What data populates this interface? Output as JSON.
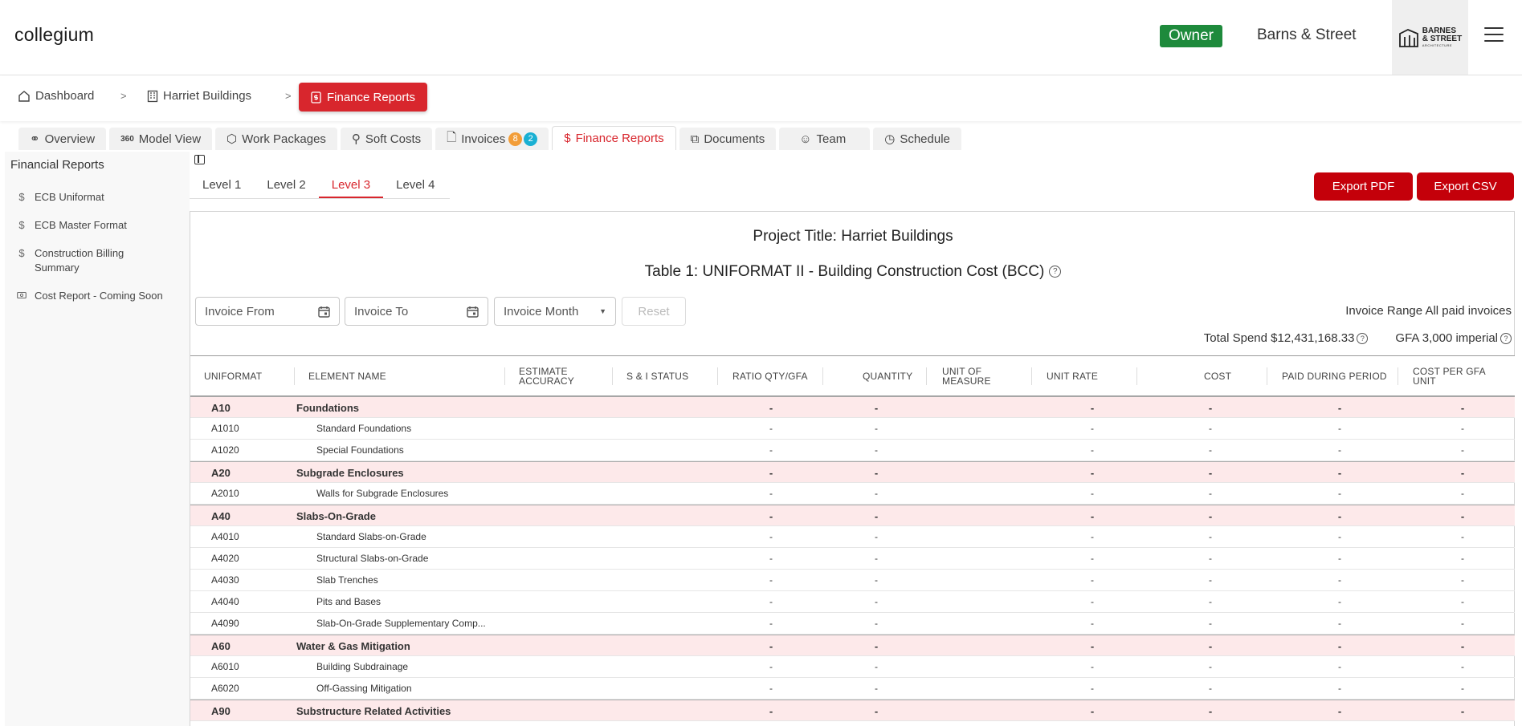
{
  "app": {
    "logo": "collegium",
    "role_badge": "Owner",
    "company": "Barns & Street",
    "company_logo_words": [
      "BARNES",
      "& STREET"
    ],
    "company_logo_sub": "ARCHITECTURE"
  },
  "breadcrumb": {
    "dashboard": "Dashboard",
    "project": "Harriet Buildings",
    "current": "Finance Reports",
    "separator": ">"
  },
  "tabs": [
    {
      "label": "Overview",
      "icon": "overview-icon"
    },
    {
      "label": "Model View",
      "icon": "360-icon"
    },
    {
      "label": "Work Packages",
      "icon": "cube-icon"
    },
    {
      "label": "Soft Costs",
      "icon": "search-icon"
    },
    {
      "label": "Invoices",
      "icon": "document-icon",
      "badges": [
        "8",
        "2"
      ]
    },
    {
      "label": "Finance Reports",
      "icon": "dollar-icon",
      "active": true
    },
    {
      "label": "Documents",
      "icon": "documents-icon"
    },
    {
      "label": "Team",
      "icon": "team-icon"
    },
    {
      "label": "Schedule",
      "icon": "clock-icon"
    }
  ],
  "sidebar": {
    "title": "Financial Reports",
    "items": [
      {
        "label": "ECB Uniformat",
        "icon": "dollar-icon"
      },
      {
        "label": "ECB Master Format",
        "icon": "dollar-icon"
      },
      {
        "label": "Construction Billing Summary",
        "icon": "dollar-icon"
      },
      {
        "label": "Cost Report - Coming Soon",
        "icon": "cash-icon"
      }
    ]
  },
  "levels": [
    "Level 1",
    "Level 2",
    "Level 3",
    "Level 4"
  ],
  "active_level": "Level 3",
  "actions": {
    "export_pdf": "Export PDF",
    "export_csv": "Export CSV"
  },
  "report": {
    "project_title": "Project Title: Harriet Buildings",
    "table_title": "Table 1: UNIFORMAT II - Building Construction Cost (BCC)",
    "filters": {
      "invoice_from": "Invoice From",
      "invoice_to": "Invoice To",
      "invoice_month": "Invoice Month",
      "reset": "Reset"
    },
    "invoice_range": "Invoice Range All paid invoices",
    "total_spend": "Total Spend $12,431,168.33",
    "gfa": "GFA 3,000 imperial"
  },
  "table": {
    "headers": [
      "UNIFORMAT",
      "ELEMENT NAME",
      "ESTIMATE ACCURACY",
      "S & I STATUS",
      "RATIO QTY/GFA",
      "QUANTITY",
      "UNIT OF MEASURE",
      "UNIT RATE",
      "COST",
      "PAID DURING PERIOD",
      "COST PER GFA UNIT"
    ],
    "empty_value": "-",
    "rows": [
      {
        "code": "A10",
        "name": "Foundations",
        "group": true
      },
      {
        "code": "A1010",
        "name": "Standard Foundations"
      },
      {
        "code": "A1020",
        "name": "Special Foundations"
      },
      {
        "code": "A20",
        "name": "Subgrade Enclosures",
        "group": true
      },
      {
        "code": "A2010",
        "name": "Walls for Subgrade Enclosures"
      },
      {
        "code": "A40",
        "name": "Slabs-On-Grade",
        "group": true
      },
      {
        "code": "A4010",
        "name": "Standard Slabs-on-Grade"
      },
      {
        "code": "A4020",
        "name": "Structural Slabs-on-Grade"
      },
      {
        "code": "A4030",
        "name": "Slab Trenches"
      },
      {
        "code": "A4040",
        "name": "Pits and Bases"
      },
      {
        "code": "A4090",
        "name": "Slab-On-Grade Supplementary Comp..."
      },
      {
        "code": "A60",
        "name": "Water & Gas Mitigation",
        "group": true
      },
      {
        "code": "A6010",
        "name": "Building Subdrainage"
      },
      {
        "code": "A6020",
        "name": "Off-Gassing Mitigation"
      },
      {
        "code": "A90",
        "name": "Substructure Related Activities",
        "group": true
      }
    ]
  },
  "colors": {
    "brand_red": "#d8262d",
    "owner_green": "#1e8a3c",
    "group_row": "#fde9ea"
  }
}
